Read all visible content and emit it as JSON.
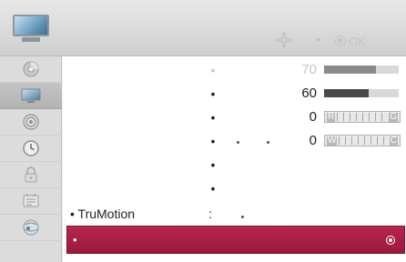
{
  "header": {
    "menu_icon": "tv-screen-icon",
    "move_icon": "move-arrows-icon",
    "ok_icon": "ok-button-icon",
    "ok_label": "OK"
  },
  "sidebar": {
    "items": [
      {
        "icon": "settings-disc-icon",
        "active": false
      },
      {
        "icon": "picture-icon",
        "active": true
      },
      {
        "icon": "audio-icon",
        "active": false
      },
      {
        "icon": "time-clock-icon",
        "active": false
      },
      {
        "icon": "lock-icon",
        "active": false
      },
      {
        "icon": "option-icon",
        "active": false
      },
      {
        "icon": "network-icon",
        "active": false
      }
    ]
  },
  "settings": {
    "rows": [
      {
        "bullet": "•",
        "value": "70",
        "level": 0.7,
        "type": "bar",
        "dim": true
      },
      {
        "bullet": "•",
        "value": "60",
        "level": 0.6,
        "type": "bar",
        "dim": false
      },
      {
        "bullet": "•",
        "value": "0",
        "scale_left": "R",
        "scale_right": "G",
        "type": "scale",
        "dim": false
      },
      {
        "bullet": "•",
        "value": "0",
        "scale_left": "W",
        "scale_right": "C",
        "type": "scale",
        "dim": false,
        "extra_dots": true
      },
      {
        "bullet": "•",
        "type": "empty"
      },
      {
        "bullet": "•",
        "type": "empty"
      }
    ],
    "trumotion": {
      "label": "• TruMotion",
      "colon": ":"
    },
    "selected": {
      "bullet": "•"
    }
  },
  "colors": {
    "highlight": "#a81f44",
    "bar_fill": "#4a4a4a",
    "bar_track": "#d9d9d9"
  }
}
